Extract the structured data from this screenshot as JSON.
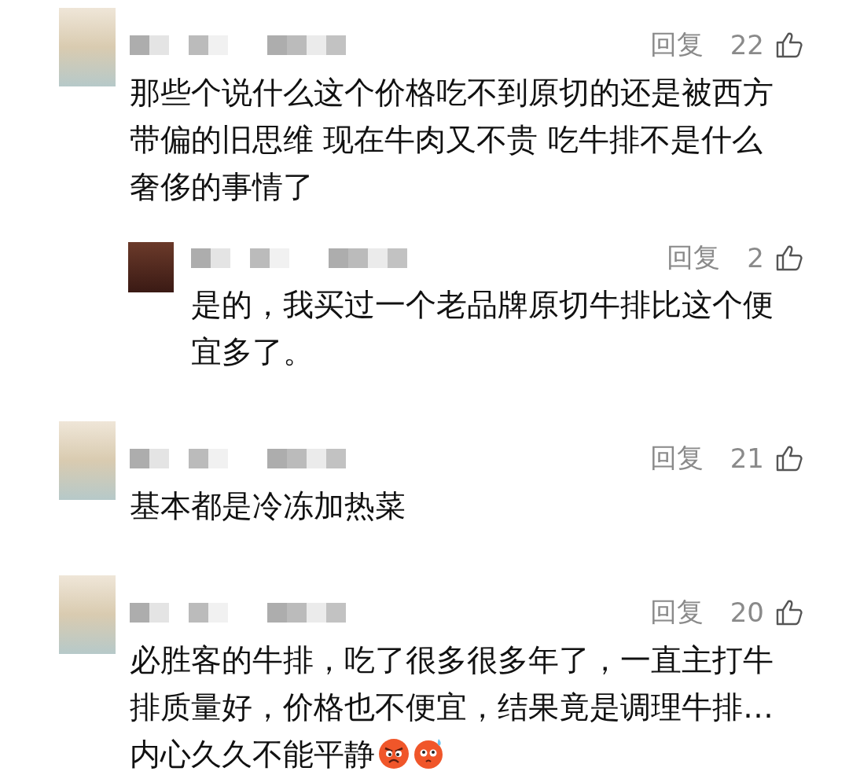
{
  "comments": [
    {
      "reply_label": "回复",
      "likes": "22",
      "text": "那些个说什么这个价格吃不到原切的还是被西方带偏的旧思维 现在牛肉又不贵 吃牛排不是什么奢侈的事情了",
      "replies": [
        {
          "reply_label": "回复",
          "likes": "2",
          "text": "是的，我买过一个老品牌原切牛排比这个便宜多了。"
        }
      ]
    },
    {
      "reply_label": "回复",
      "likes": "21",
      "text": "基本都是冷冻加热菜"
    },
    {
      "reply_label": "回复",
      "likes": "20",
      "text": "必胜客的牛排，吃了很多很多年了，一直主打牛排质量好，价格也不便宜，结果竟是调理牛排…内心久久不能平静",
      "emojis": [
        {
          "kind": "angry"
        },
        {
          "kind": "sweat"
        }
      ]
    }
  ]
}
